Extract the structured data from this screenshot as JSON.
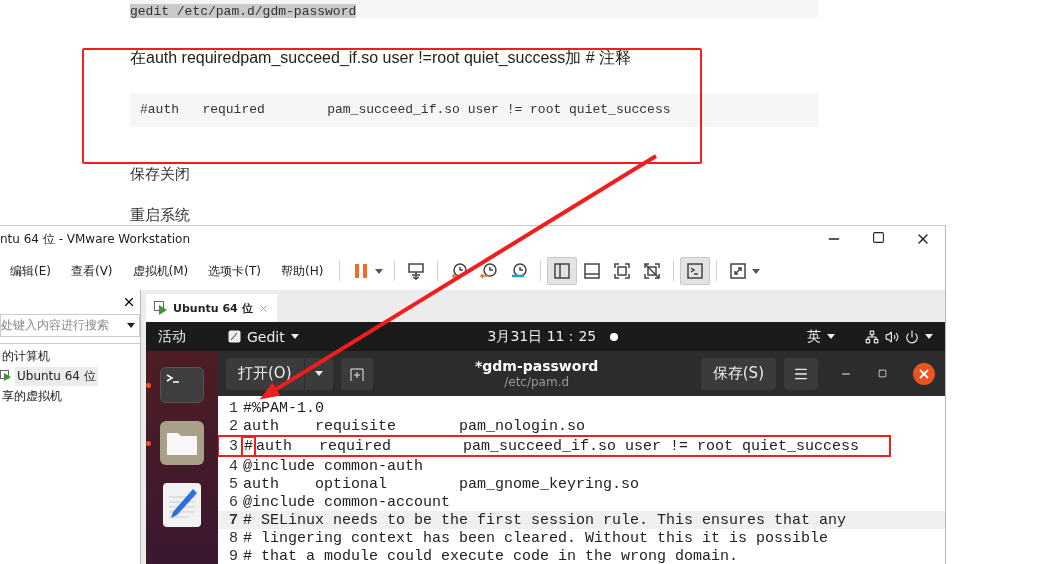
{
  "article": {
    "code_top": "gedit /etc/pam.d/gdm-password",
    "instruction": "在auth requiredpam_succeed_if.so user !=root quiet_success加 # 注释",
    "code_block": "#auth   required        pam_succeed_if.so user != root quiet_success",
    "paragraphs": [
      "保存关闭",
      "重启系统"
    ]
  },
  "vmware": {
    "title": "ntu 64 位 - VMware Workstation",
    "menu": [
      {
        "label": "编辑(E)"
      },
      {
        "label": "查看(V)"
      },
      {
        "label": "虚拟机(M)"
      },
      {
        "label": "选项卡(T)"
      },
      {
        "label": "帮助(H)"
      }
    ],
    "toolbar": [
      {
        "kind": "pause",
        "selected": false,
        "has_menu": true
      },
      {
        "kind": "send-keys",
        "selected": false,
        "has_menu": false
      },
      {
        "kind": "snapshot-take",
        "selected": false,
        "has_menu": false
      },
      {
        "kind": "snapshot-revert",
        "selected": false,
        "has_menu": false
      },
      {
        "kind": "snapshot-manager",
        "selected": false,
        "has_menu": false
      },
      {
        "kind": "view-library",
        "selected": true,
        "has_menu": false
      },
      {
        "kind": "view-thumbnail",
        "selected": false,
        "has_menu": false
      },
      {
        "kind": "fullscreen",
        "selected": false,
        "has_menu": false
      },
      {
        "kind": "unity",
        "selected": false,
        "has_menu": false
      },
      {
        "kind": "console",
        "selected": true,
        "has_menu": false
      },
      {
        "kind": "stretch",
        "selected": false,
        "has_menu": true
      }
    ],
    "library": {
      "search_placeholder": "处键入内容进行搜索",
      "items": [
        {
          "label": "的计算机",
          "selected": false,
          "children": [
            {
              "label": "Ubuntu 64 位",
              "selected": true
            }
          ]
        },
        {
          "label": "享的虚拟机",
          "selected": false
        }
      ]
    },
    "tabs": [
      {
        "label": "Ubuntu 64 位",
        "selected": true
      }
    ]
  },
  "ubuntu": {
    "activities": "活动",
    "app": "Gedit",
    "clock": "3月31日  11：25",
    "input_method": "英",
    "dock": [
      {
        "kind": "terminal",
        "running": true
      },
      {
        "kind": "files",
        "running": true
      },
      {
        "kind": "editor",
        "running": false
      }
    ]
  },
  "gedit": {
    "open": "打开(O)",
    "title": "*gdm-password",
    "subtitle": "/etc/pam.d",
    "save": "保存(S)",
    "lines": [
      {
        "number": "1",
        "text": "#%PAM-1.0",
        "current": false,
        "annotated": false
      },
      {
        "number": "2",
        "text": "auth    requisite       pam_nologin.so",
        "current": false,
        "annotated": false
      },
      {
        "number": "3",
        "text": "#auth   required        pam_succeed_if.so user != root quiet_success",
        "current": false,
        "annotated": true
      },
      {
        "number": "4",
        "text": "@include common-auth",
        "current": false,
        "annotated": false
      },
      {
        "number": "5",
        "text": "auth    optional        pam_gnome_keyring.so",
        "current": false,
        "annotated": false
      },
      {
        "number": "6",
        "text": "@include common-account",
        "current": false,
        "annotated": false
      },
      {
        "number": "7",
        "text": "# SELinux needs to be the first session rule. This ensures that any",
        "current": true,
        "annotated": false
      },
      {
        "number": "8",
        "text": "# lingering context has been cleared. Without this it is possible",
        "current": false,
        "annotated": false
      },
      {
        "number": "9",
        "text": "# that a module could execute code in the wrong domain.",
        "current": false,
        "annotated": false
      }
    ]
  }
}
